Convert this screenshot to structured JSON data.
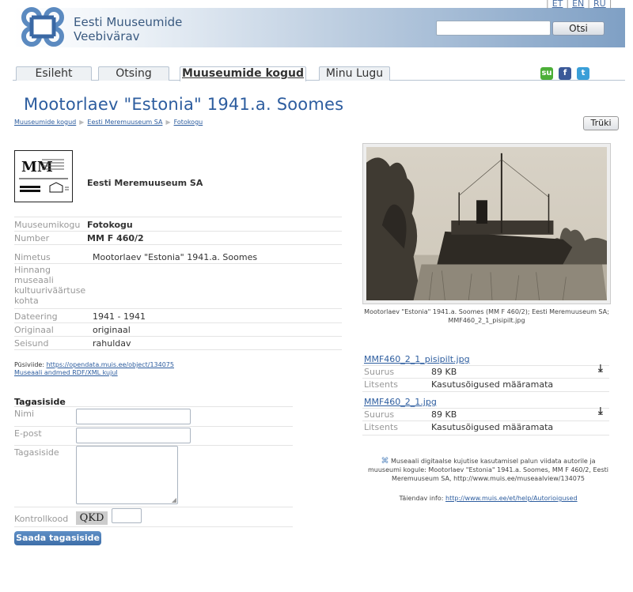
{
  "header": {
    "logo_text_line1": "Eesti Muuseumide",
    "logo_text_line2": "Veebivärav",
    "languages": [
      "ET",
      "EN",
      "RU"
    ],
    "search_placeholder": "",
    "search_button": "Otsi"
  },
  "tabs": [
    {
      "label": "Esileht"
    },
    {
      "label": "Otsing"
    },
    {
      "label": "Muuseumide kogud",
      "active": true
    },
    {
      "label": "Minu Lugu"
    }
  ],
  "social": [
    {
      "name": "stumbleupon-icon",
      "glyph": "su",
      "color": "#4caf38"
    },
    {
      "name": "facebook-icon",
      "glyph": "f",
      "color": "#3b5998"
    },
    {
      "name": "twitter-icon",
      "glyph": "t",
      "color": "#3a9fd8"
    }
  ],
  "page": {
    "title": "Mootorlaev \"Estonia\" 1941.a. Soomes",
    "print_button": "Trüki",
    "breadcrumb": [
      "Muuseumide kogud",
      "Eesti Meremuuseum SA",
      "Fotokogu"
    ]
  },
  "museum": {
    "name": "Eesti Meremuuseum SA"
  },
  "details": {
    "collection_label": "Muuseumikogu",
    "collection_value": "Fotokogu",
    "number_label": "Number",
    "number_value": "MM F 460/2",
    "name_label": "Nimetus",
    "name_value": "Mootorlaev \"Estonia\" 1941.a. Soomes",
    "evaluation_label_1": "Hinnang",
    "evaluation_label_2": "museaali",
    "evaluation_label_3": "kultuuriväärtuse",
    "evaluation_label_4": "kohta",
    "dating_label": "Dateering",
    "dating_value": "1941 - 1941",
    "original_label": "Originaal",
    "original_value": "originaal",
    "condition_label": "Seisund",
    "condition_value": "rahuldav"
  },
  "links": {
    "permalink_label": "Püsiviide: ",
    "permalink_url": "https://opendata.muis.ee/object/134075",
    "rdf_link": "Museaali andmed RDF/XML kujul"
  },
  "feedback": {
    "title": "Tagasiside",
    "name_label": "Nimi",
    "email_label": "E-post",
    "message_label": "Tagasiside",
    "captcha_label": "Kontrollkood",
    "captcha_code": "QKD",
    "submit": "Saada tagasiside"
  },
  "image": {
    "caption": "Mootorlaev \"Estonia\" 1941.a. Soomes (MM F 460/2); Eesti Meremuuseum SA; MMF460_2_1_pisipilt.jpg"
  },
  "files": [
    {
      "name": "MMF460_2_1_pisipilt.jpg",
      "size_label": "Suurus",
      "size": "89 KB",
      "license_label": "Litsents",
      "license": "Kasutusõigused määramata"
    },
    {
      "name": "MMF460_2_1.jpg",
      "size_label": "Suurus",
      "size": "89 KB",
      "license_label": "Litsents",
      "license": "Kasutusõigused määramata"
    }
  ],
  "notice": {
    "text": "Museaali digitaalse kujutise kasutamisel palun viidata autorile ja muuseumi kogule: Mootorlaev \"Estonia\" 1941.a. Soomes, MM F 460/2, Eesti Meremuuseum SA, http://www.muis.ee/museaalview/134075",
    "extra_label": "Täiendav info: ",
    "extra_url": "http://www.muis.ee/et/help/Autorioigused"
  },
  "colors": {
    "accent": "#2d5d9f",
    "header_gradient_end": "#7e9fc4"
  }
}
